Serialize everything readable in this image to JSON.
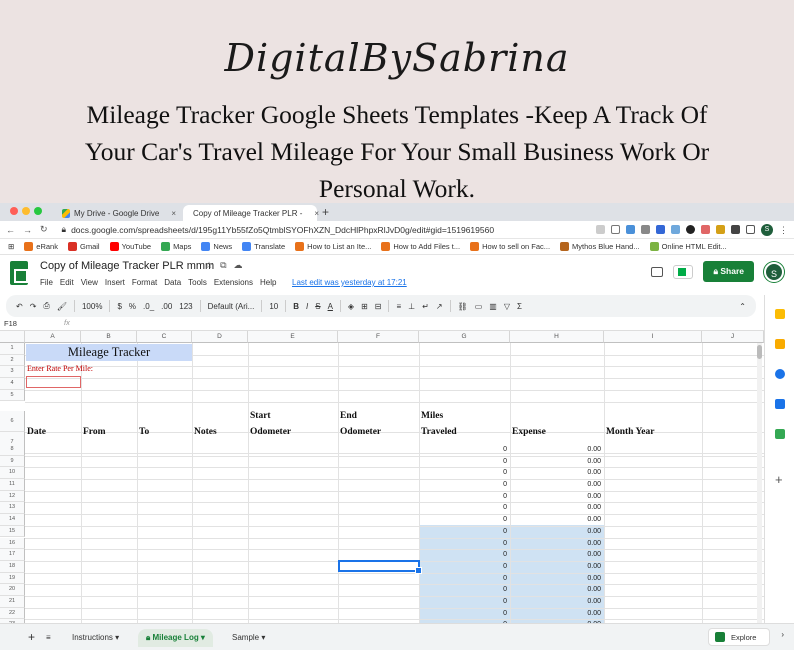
{
  "banner": {
    "brand": "DigitalBySabrina",
    "headline_line1": "Mileage Tracker Google Sheets Templates -Keep A Track Of",
    "headline_line2": "Your Car's Travel Mileage For Your Small Business Work Or",
    "headline_line3": "Personal Work."
  },
  "browser": {
    "tabs": [
      {
        "label": "My Drive - Google Drive",
        "close": "×"
      },
      {
        "label": "Copy of Mileage Tracker PLR -",
        "close": "×"
      }
    ],
    "new_tab": "+",
    "url": "docs.google.com/spreadsheets/d/195g11Yb55fZo5QtmblSYOFhXZN_DdcHlPhpxRlJvD0g/edit#gid=1519619560",
    "profile_letter": "S",
    "bookmarks": [
      "eRank",
      "Gmail",
      "YouTube",
      "Maps",
      "News",
      "Translate",
      "How to List an Ite...",
      "How to Add Files t...",
      "How to sell on Fac...",
      "Mythos Blue Hand...",
      "Online HTML Edit..."
    ],
    "bookmark_colors": [
      "#e8711a",
      "#d93025",
      "#ff0000",
      "#34a853",
      "#4285f4",
      "#4285f4",
      "#e8711a",
      "#e8711a",
      "#e8711a",
      "#b5651d",
      "#7cb342"
    ]
  },
  "sheets": {
    "doc_title": "Copy of Mileage Tracker PLR mmm",
    "menus": [
      "File",
      "Edit",
      "View",
      "Insert",
      "Format",
      "Data",
      "Tools",
      "Extensions",
      "Help"
    ],
    "last_edit": "Last edit was yesterday at 17:21",
    "share_label": "Share",
    "avatar_letter": "S",
    "toolbar": {
      "zoom": "100%",
      "currency": "$",
      "percent": "%",
      "dec_less": ".0_",
      "dec_more": ".00",
      "format_123": "123",
      "font": "Default (Ari...",
      "size": "10",
      "bold": "B",
      "italic": "I",
      "strike": "S",
      "text_color": "A",
      "sum": "Σ"
    },
    "name_box": "F18",
    "fx": "fx",
    "columns": [
      "A",
      "B",
      "C",
      "D",
      "E",
      "F",
      "G",
      "H",
      "I",
      "J"
    ],
    "rows": [
      "1",
      "2",
      "3",
      "4",
      "5",
      "6",
      "7",
      "8",
      "9",
      "10",
      "11",
      "12",
      "13",
      "14",
      "15",
      "16",
      "17",
      "18",
      "19",
      "20",
      "21",
      "22",
      "23"
    ],
    "cells": {
      "title": "Mileage Tracker",
      "rate_label": "Enter Rate Per Mile:",
      "start_top": "Start",
      "end_top": "End",
      "miles_top": "Miles",
      "headers": [
        "Date",
        "From",
        "To",
        "Notes",
        "Odometer",
        "Odometer",
        "Traveled",
        "Expense",
        "Month Year"
      ]
    },
    "miles_values": [
      "0",
      "0",
      "0",
      "0",
      "0",
      "0",
      "0",
      "0",
      "0",
      "0",
      "0",
      "0",
      "0",
      "0",
      "0",
      "0"
    ],
    "expense_values": [
      "0.00",
      "0.00",
      "0.00",
      "0.00",
      "0.00",
      "0.00",
      "0.00",
      "0.00",
      "0.00",
      "0.00",
      "0.00",
      "0.00",
      "0.00",
      "0.00",
      "0.00",
      "0.00"
    ],
    "sheet_tabs": [
      {
        "label": "Instructions ▾"
      },
      {
        "label": "Mileage Log ▾"
      },
      {
        "label": "Sample ▾"
      }
    ],
    "add_sheet": "+",
    "all_sheets": "≡",
    "explore_label": "Explore"
  }
}
